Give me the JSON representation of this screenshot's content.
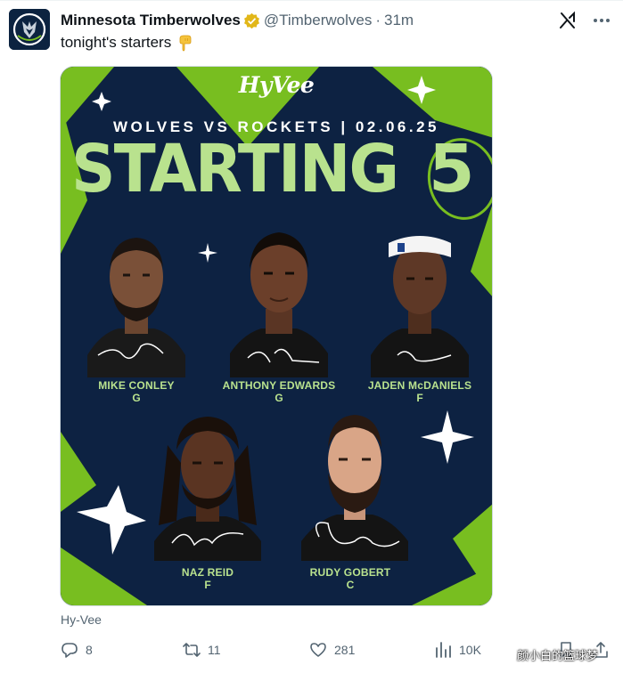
{
  "account": {
    "display_name": "Minnesota Timberwolves",
    "handle": "@Timberwolves",
    "separator": "·",
    "time": "31m"
  },
  "tweet": {
    "text": "tonight's starters",
    "emoji_name": "backhand-index-pointing-down"
  },
  "graphic": {
    "sponsor": "HyVee",
    "matchup": "WOLVES VS ROCKETS | 02.06.25",
    "title": "STARTING",
    "title_number": "5",
    "players": [
      {
        "name": "MIKE CONLEY",
        "position": "G"
      },
      {
        "name": "ANTHONY EDWARDS",
        "position": "G"
      },
      {
        "name": "JADEN McDANIELS",
        "position": "F"
      },
      {
        "name": "NAZ REID",
        "position": "F"
      },
      {
        "name": "RUDY GOBERT",
        "position": "C"
      }
    ]
  },
  "caption": "Hy-Vee",
  "actions": {
    "replies": "8",
    "reposts": "11",
    "likes": "281",
    "views": "10K"
  },
  "watermark": "颜小白的篮球梦",
  "colors": {
    "navy": "#0d2242",
    "green": "#78be20",
    "light_green": "#b9e28e",
    "verified_gold": "#e2b719",
    "muted_text": "#536471"
  }
}
